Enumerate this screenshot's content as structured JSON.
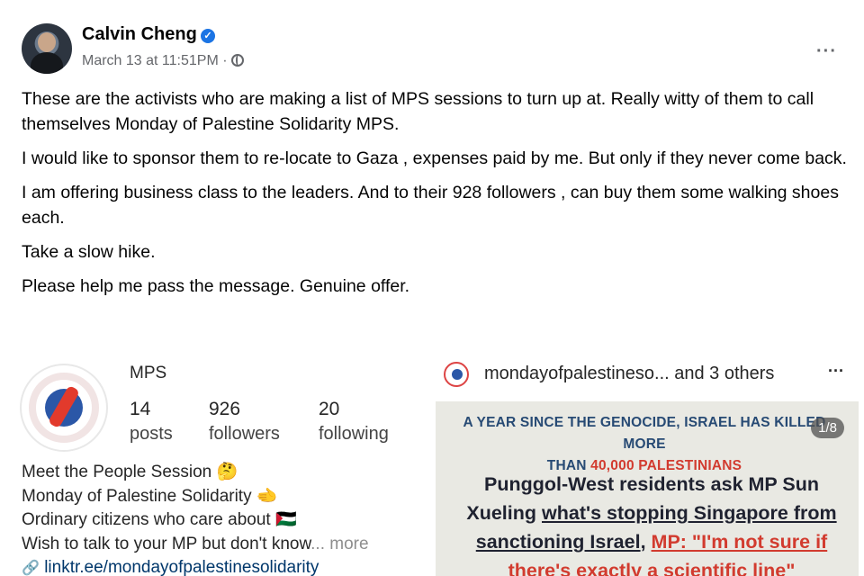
{
  "post": {
    "author": "Calvin Cheng",
    "timestamp": "March 13 at 11:51PM ·",
    "paragraphs": [
      "These are the activists who are making a list of MPS sessions to turn up at.  Really witty of them to call themselves Monday of Palestine Solidarity  MPS.",
      "I would like to sponsor them to re-locate to Gaza , expenses paid by me. But only if they never come back.",
      "I am offering business class to the leaders.   And to their 928 followers , can buy them some walking shoes each.",
      "Take a slow hike.",
      "Please help me pass the message. Genuine offer."
    ]
  },
  "ig_profile": {
    "name": "MPS",
    "posts_count": "14",
    "posts_label": "posts",
    "followers_count": "926",
    "followers_label": "followers",
    "following_count": "20",
    "following_label": "following",
    "bio_line1": "Meet the People Session 🤔",
    "bio_line2": "Monday of Palestine Solidarity 🫲",
    "bio_line3": "Ordinary citizens who care about 🇵🇸",
    "bio_line4": "Wish to talk to your MP but don't know",
    "bio_more": "... more",
    "link": "linktr.ee/mondayofpalestinesolidarity"
  },
  "ig_post": {
    "user": "mondayofpalestineso... and 3 others",
    "counter": "1/8",
    "headline_line1": "A YEAR SINCE THE GENOCIDE, ISRAEL HAS KILLED MORE",
    "headline_line2_a": "THAN ",
    "headline_line2_b": "40,000 PALESTINIANS",
    "title_line1": "Punggol-West residents ask MP Sun",
    "title_line2_a": "Xueling ",
    "title_line2_b": "what's stopping Singapore from",
    "title_line3_a": "sanctioning Israel",
    "title_line3_b": ", ",
    "title_line3_c": "MP: \"I'm not sure if",
    "title_line4": "there's exactly a scientific line\""
  },
  "icons": [
    "verified-icon",
    "globe-icon",
    "more-icon",
    "link-icon"
  ],
  "colors": {
    "accent": "#1b74e4",
    "poster_blue": "#274a74",
    "poster_red": "#d23b2f"
  }
}
